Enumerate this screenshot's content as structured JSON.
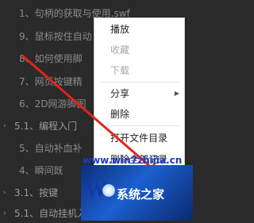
{
  "sidebar": {
    "items": [
      {
        "arrow": "",
        "label": "1、句柄的获取与使用.swf",
        "type": "sub"
      },
      {
        "arrow": "",
        "label": "9、鼠标按住自动",
        "type": "sub"
      },
      {
        "arrow": "",
        "label": "8、如何使用脚",
        "type": "sub"
      },
      {
        "arrow": "",
        "label": "7、网页按键精",
        "type": "sub"
      },
      {
        "arrow": "",
        "label": "6、2D网游脚图",
        "type": "sub"
      },
      {
        "arrow": "›",
        "label": "5.1、编程入门",
        "type": "sec"
      },
      {
        "arrow": "",
        "label": "5、自动补血补",
        "type": "sub"
      },
      {
        "arrow": "",
        "label": "4、瞬间既",
        "type": "sub"
      },
      {
        "arrow": "›",
        "label": "3.1、按键",
        "type": "sec"
      },
      {
        "arrow": "›",
        "label": "5.1、自动挂机入门",
        "type": "sec"
      }
    ]
  },
  "context_menu": {
    "items": [
      {
        "label": "播放",
        "disabled": false,
        "has_submenu": false
      },
      {
        "label": "收藏",
        "disabled": true,
        "has_submenu": false
      },
      {
        "label": "下载",
        "disabled": true,
        "has_submenu": false
      },
      {
        "label": "分享",
        "disabled": false,
        "has_submenu": true
      },
      {
        "label": "删除",
        "disabled": false,
        "has_submenu": false
      },
      {
        "label": "打开文件目录",
        "disabled": false,
        "has_submenu": false
      },
      {
        "label": "删除全部记录",
        "disabled": false,
        "has_submenu": false
      }
    ]
  },
  "watermark": {
    "url_text": "www.win7zhijia.cn",
    "logo_mark": "W",
    "logo_text": "系统之家"
  },
  "colors": {
    "background": "#2a2a2a",
    "menu_bg": "#ffffff",
    "arrow_red": "#e0241b"
  }
}
